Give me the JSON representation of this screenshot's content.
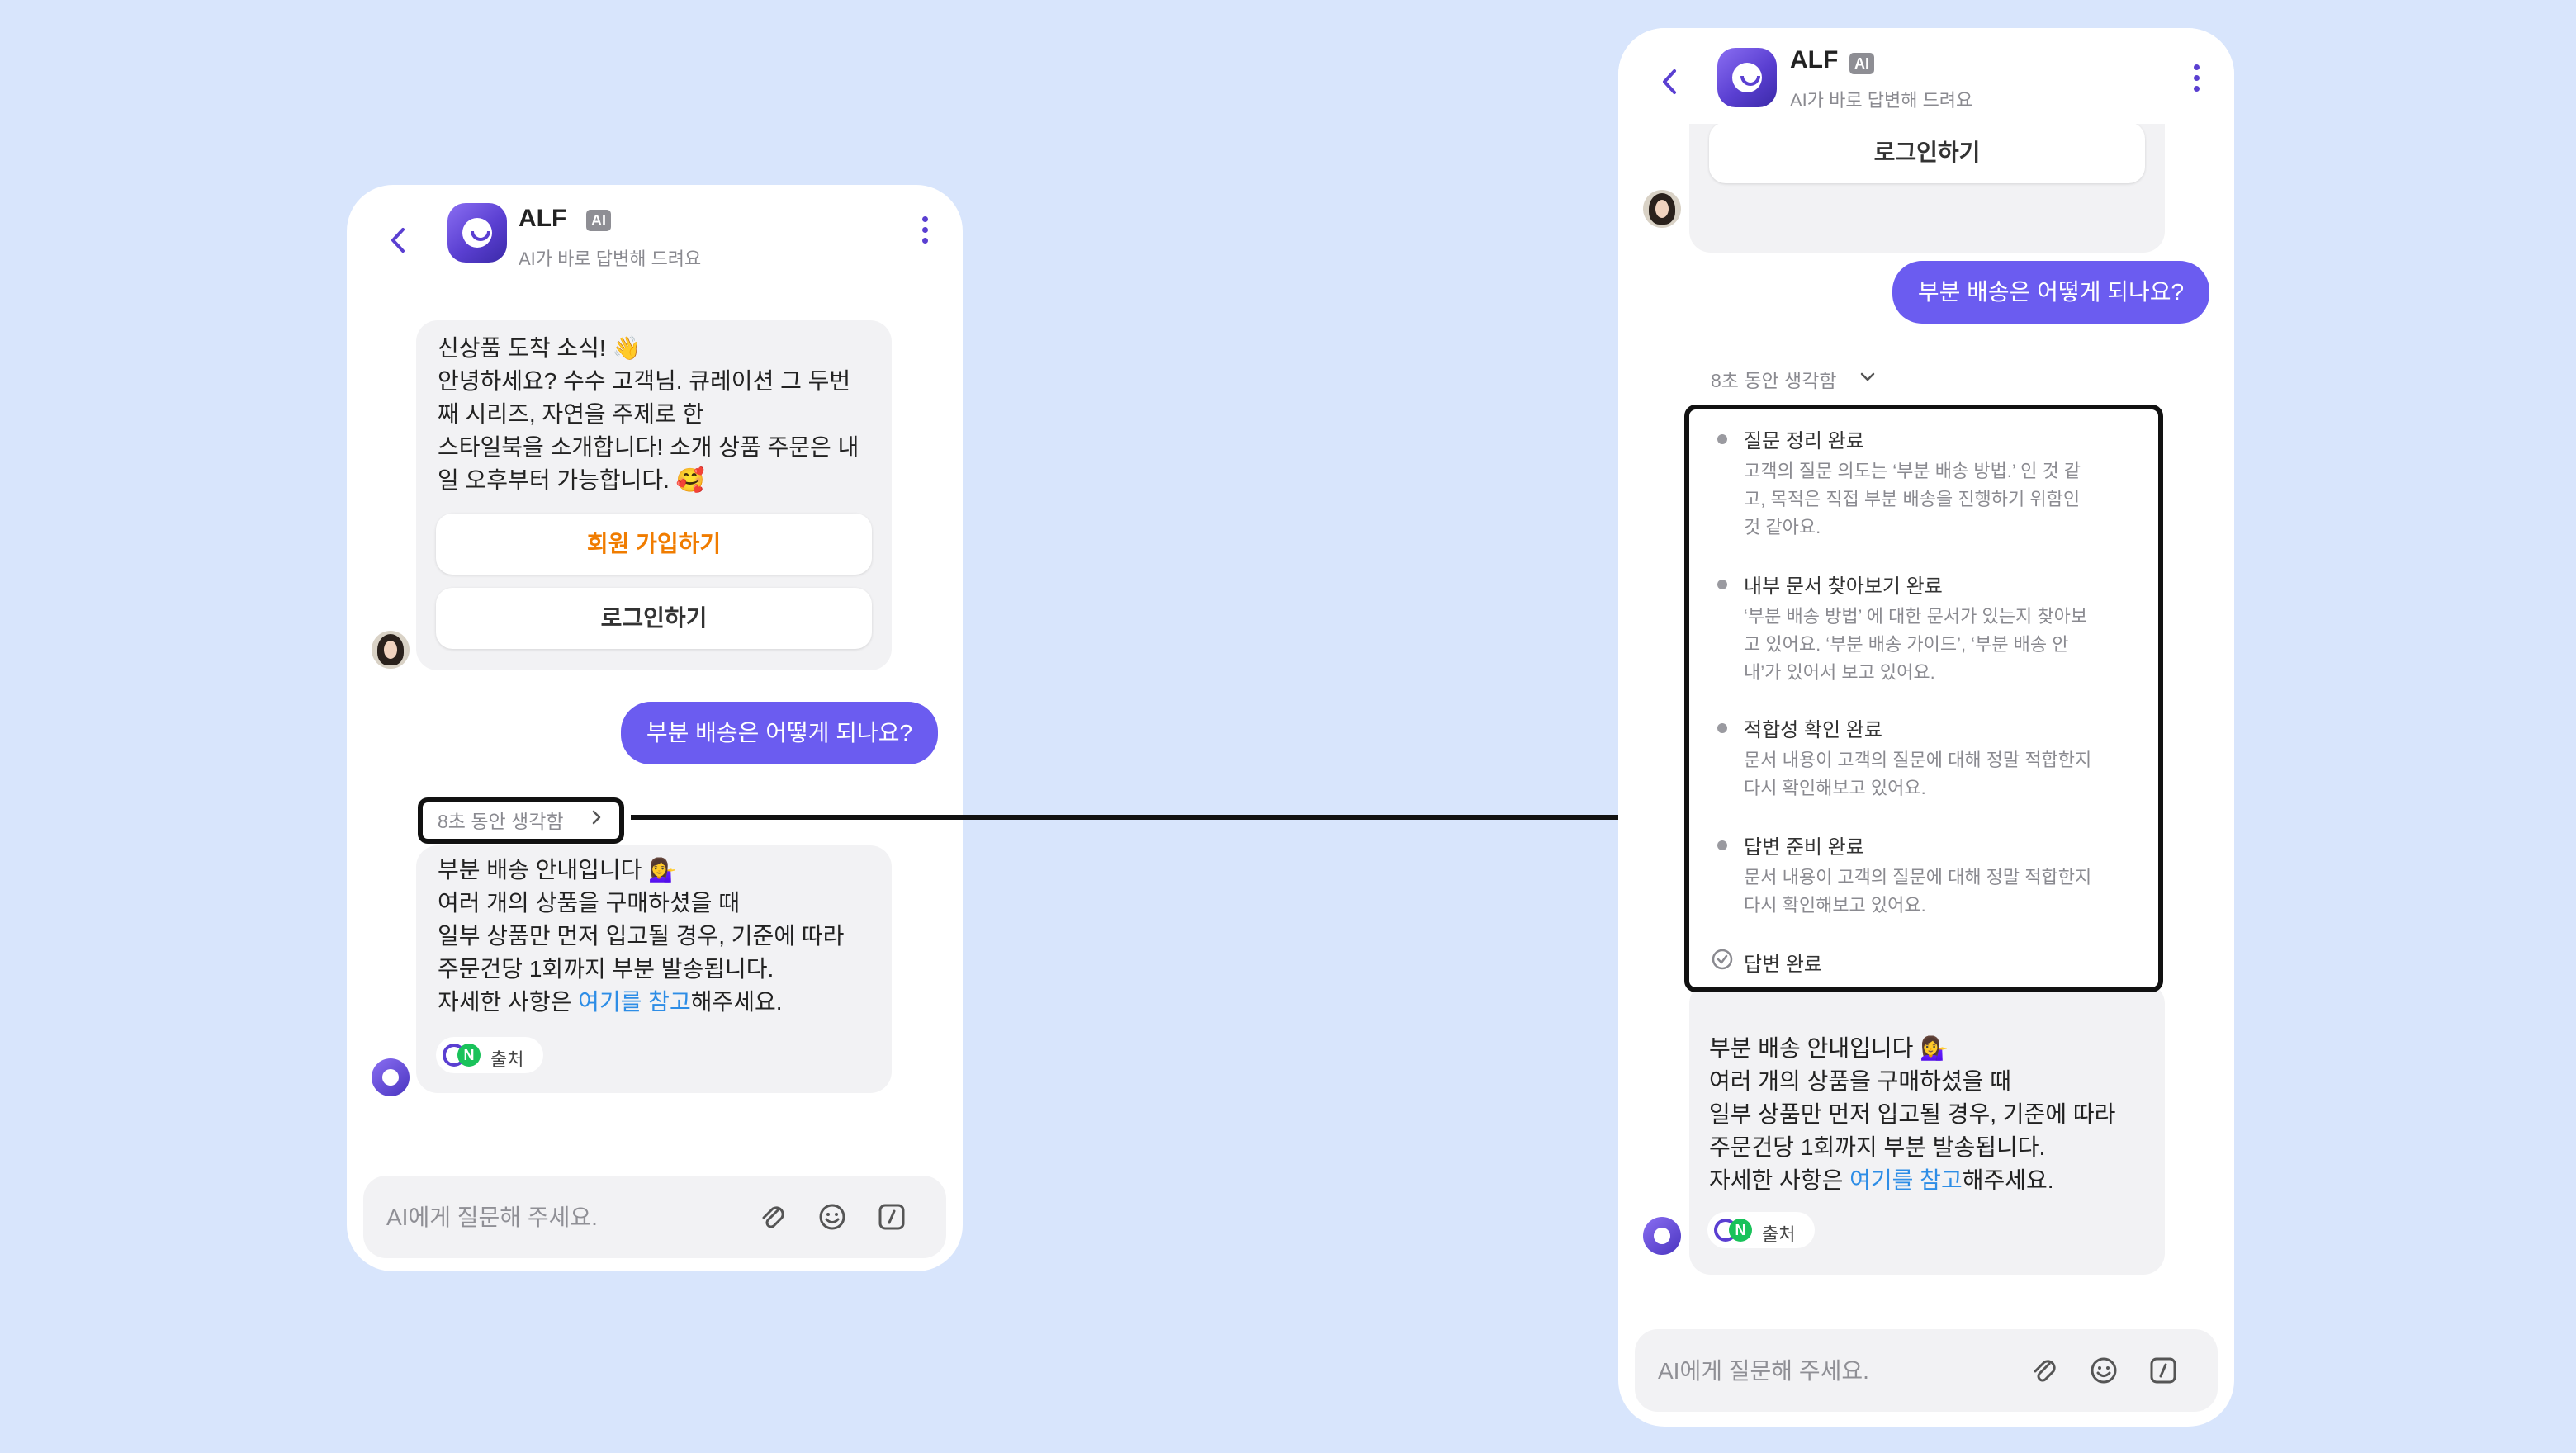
{
  "app": {
    "brand": "ALF",
    "ai_badge": "AI",
    "subtitle": "AI가 바로 답변해 드려요"
  },
  "left": {
    "welcome_message": "신상품 도착 소식! 👋\n안녕하세요? 수수 고객님. 큐레이션 그 두번\n째 시리즈, 자연을 주제로 한\n스타일북을 소개합니다! 소개 상품 주문은 내\n일 오후부터 가능합니다. 🥰",
    "signup_button": "회원 가입하기",
    "login_button": "로그인하기",
    "user_message": "부분 배송은 어떻게 되나요?",
    "thought_label": "8초 동안 생각함",
    "answer_lines": "부분 배송 안내입니다 💁‍♀️\n여러 개의 상품을 구매하셨을 때\n일부 상품만 먼저 입고될 경우, 기준에 따라\n주문건당 1회까지 부분 발송됩니다.",
    "answer_prefix": "자세한 사항은 ",
    "answer_link": "여기를 참고",
    "answer_suffix": "해주세요.",
    "source_chip": "출처",
    "composer_placeholder": "AI에게 질문해 주세요."
  },
  "right": {
    "login_button": "로그인하기",
    "user_message": "부분 배송은 어떻게 되나요?",
    "thought_label": "8초 동안 생각함",
    "steps": [
      {
        "title": "질문 정리 완료",
        "body": "고객의 질문 의도는 ‘부분 배송 방법.’ 인 것 같\n고, 목적은 직접 부분 배송을 진행하기 위함인\n것 같아요."
      },
      {
        "title": "내부 문서 찾아보기 완료",
        "body": "‘부분 배송 방법’ 에 대한 문서가 있는지 찾아보\n고 있어요. ‘부분 배송 가이드’, ‘부분 배송 안\n내’가 있어서 보고 있어요."
      },
      {
        "title": "적합성 확인 완료",
        "body": "문서 내용이 고객의 질문에 대해 정말 적합한지\n다시 확인해보고 있어요."
      },
      {
        "title": "답변 준비 완료",
        "body": "문서 내용이 고객의 질문에 대해 정말 적합한지\n다시 확인해보고 있어요."
      }
    ],
    "final_step": "답변 완료",
    "answer_lines": "부분 배송 안내입니다 💁‍♀️\n여러 개의 상품을 구매하셨을 때\n일부 상품만 먼저 입고될 경우, 기준에 따라\n주문건당 1회까지 부분 발송됩니다.",
    "answer_prefix": "자세한 사항은 ",
    "answer_link": "여기를 참고",
    "answer_suffix": "해주세요.",
    "source_chip": "출처",
    "composer_placeholder": "AI에게 질문해 주세요."
  },
  "colors": {
    "background": "#d8e5fc",
    "accent": "#6b5cf0",
    "signup_orange": "#f07c00",
    "link_blue": "#2d8de6"
  },
  "icons": [
    "back-chevron-icon",
    "more-vertical-icon",
    "attachment-icon",
    "emoji-icon",
    "slash-command-icon",
    "chevron-right-icon",
    "chevron-down-icon",
    "check-circle-icon",
    "arrow-right-icon"
  ]
}
